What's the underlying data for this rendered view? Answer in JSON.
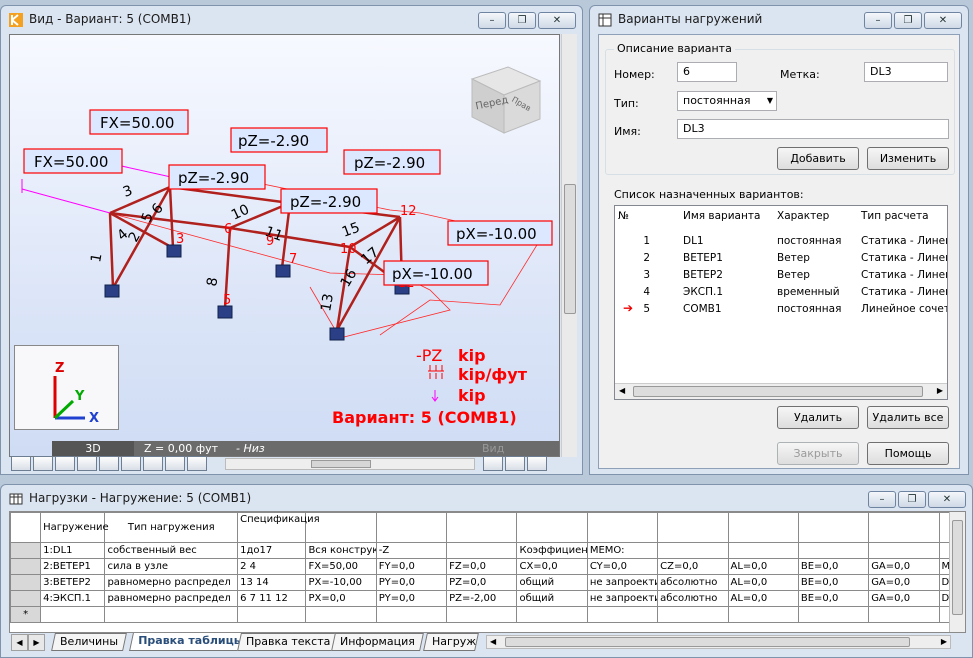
{
  "view_window": {
    "title": "Вид - Вариант: 5 (COMB1)",
    "cube_label_front": "Перед",
    "cube_label_right": "Прав",
    "mode_3d": "3D",
    "z_readout": "Z = 0,00 фут",
    "z_readout_suffix": "- Низ",
    "view_btn": "Вид",
    "legend": {
      "pz": "-PZ",
      "u1": "kip",
      "u2": "kip/фут",
      "u3": "kip",
      "case": "Вариант: 5 (COMB1)"
    },
    "axes": {
      "x": "X",
      "y": "Y",
      "z": "Z"
    },
    "loads": {
      "fx1": "FX=50.00",
      "fx2": "FX=50.00",
      "pz1": "pZ=-2.90",
      "pz2": "pZ=-2.90",
      "pz3": "pZ=-2.90",
      "pz4": "pZ=-2.90",
      "px1": "pX=-10.00",
      "px2": "pX=-10.00"
    },
    "nodes": [
      "3",
      "5",
      "6",
      "7",
      "9",
      "10",
      "12",
      "12"
    ],
    "members": [
      "1",
      "2",
      "3",
      "4",
      "5",
      "6",
      "8",
      "10",
      "11",
      "13",
      "15",
      "16",
      "17"
    ]
  },
  "cases_window": {
    "title": "Варианты нагружений",
    "group_desc": "Описание варианта",
    "number_label": "Номер:",
    "number_value": "6",
    "tag_label": "Метка:",
    "tag_value": "DL3",
    "type_label": "Тип:",
    "type_value": "постоянная",
    "name_label": "Имя:",
    "name_value": "DL3",
    "add_btn": "Добавить",
    "change_btn": "Изменить",
    "group_list": "Список назначенных вариантов:",
    "columns": [
      "№",
      "Имя варианта",
      "Характер",
      "Тип расчета"
    ],
    "rows": [
      [
        "1",
        "DL1",
        "постоянная",
        "Статика - Линей"
      ],
      [
        "2",
        "ВЕТЕР1",
        "Ветер",
        "Статика - Линей"
      ],
      [
        "3",
        "ВЕТЕР2",
        "Ветер",
        "Статика - Линей"
      ],
      [
        "4",
        "ЭКСП.1",
        "временный",
        "Статика - Линей"
      ],
      [
        "5",
        "COMB1",
        "постоянная",
        "Линейное сочет"
      ]
    ],
    "delete_btn": "Удалить",
    "delete_all_btn": "Удалить все",
    "close_btn": "Закрыть",
    "help_btn": "Помощь"
  },
  "loads_window": {
    "title": "Нагрузки - Нагружение: 5 (COMB1)",
    "headers": [
      "",
      "Нагружение",
      "Тип нагружения",
      "Спецификация",
      "",
      "",
      "",
      "",
      "",
      "",
      "",
      "",
      "",
      ""
    ],
    "rows": [
      [
        "1:DL1",
        "собственный вес",
        "1до17",
        "Вся конструк",
        "-Z",
        "",
        "Коэффициен",
        "MEMO:",
        "",
        "",
        "",
        "",
        "",
        ""
      ],
      [
        "2:ВЕТЕР1",
        "сила в узле",
        "2 4",
        "FX=50,00",
        "FY=0,0",
        "FZ=0,0",
        "CX=0,0",
        "CY=0,0",
        "CZ=0,0",
        "AL=0,0",
        "BE=0,0",
        "GA=0,0",
        "MEMO"
      ],
      [
        "3:ВЕТЕР2",
        "равномерно распредел",
        "13 14",
        "PX=-10,00",
        "PY=0,0",
        "PZ=0,0",
        "общий",
        "не запроекти",
        "абсолютно",
        "AL=0,0",
        "BE=0,0",
        "GA=0,0",
        "DY"
      ],
      [
        "4:ЭКСП.1",
        "равномерно распредел",
        "6 7 11 12",
        "PX=0,0",
        "PY=0,0",
        "PZ=-2,00",
        "общий",
        "не запроекти",
        "абсолютно",
        "AL=0,0",
        "BE=0,0",
        "GA=0,0",
        "DY"
      ]
    ],
    "new_row": "*",
    "tabs": [
      "Величины",
      "Правка таблицы",
      "Правка текста",
      "Информация",
      "Нагруже"
    ]
  }
}
